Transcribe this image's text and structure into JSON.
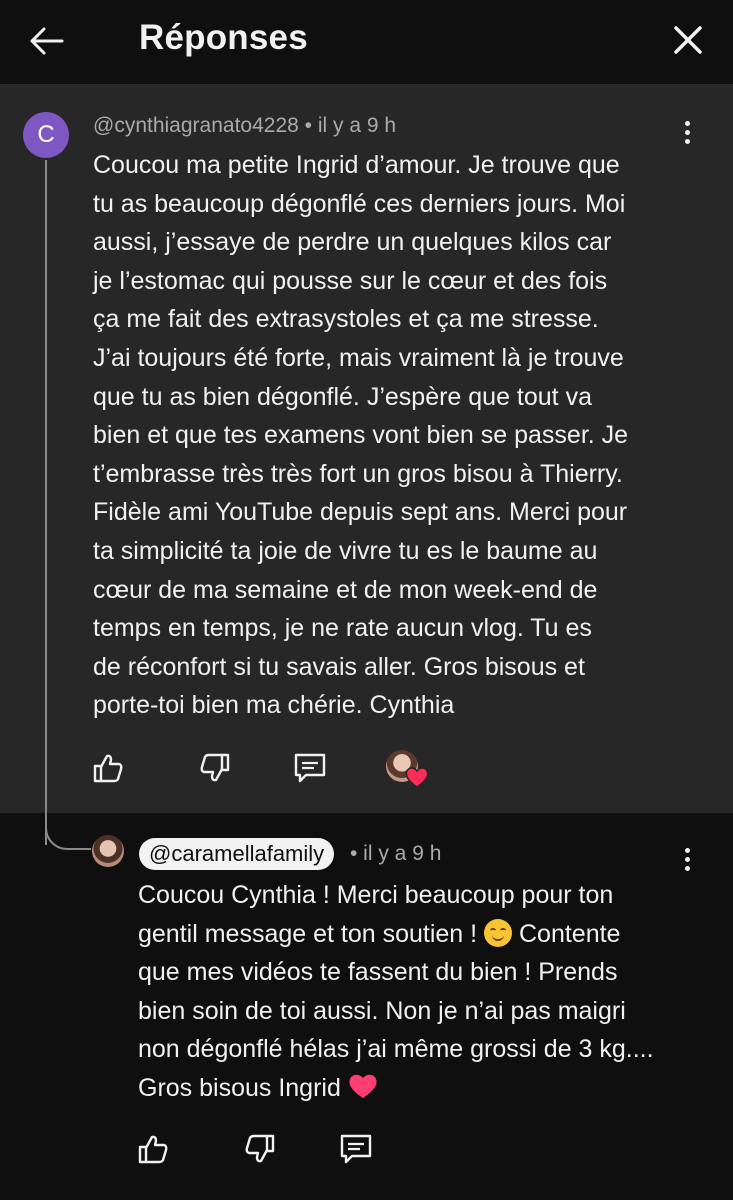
{
  "header": {
    "title": "Réponses",
    "back_icon": "arrow-left-icon",
    "close_icon": "close-icon"
  },
  "parent_comment": {
    "avatar_letter": "C",
    "avatar_color": "#7e57c2",
    "handle": "@cynthiagranato4228",
    "time": "• il y a 9 h",
    "lines": [
      "Coucou ma petite Ingrid d’amour. Je trouve que",
      "tu as beaucoup dégonflé ces derniers jours. Moi",
      "aussi, j’essaye de perdre un quelques kilos car",
      "je l’estomac qui pousse sur le cœur et des fois",
      "ça me fait des extrasystoles et ça me stresse.",
      "J’ai toujours été forte, mais vraiment là je trouve",
      "que tu as bien dégonflé. J’espère que tout va",
      "bien et que tes examens vont bien se passer. Je",
      "t’embrasse très très fort un gros bisou à Thierry.",
      "Fidèle ami YouTube depuis sept ans. Merci pour",
      "ta simplicité ta joie de vivre tu es le baume au",
      "cœur de ma semaine et de mon week-end de",
      "temps en temps, je ne rate aucun vlog. Tu es",
      "de réconfort si tu savais aller. Gros bisous et",
      "porte-toi bien ma chérie. Cynthia"
    ],
    "actions": [
      "thumbs-up-icon",
      "thumbs-down-icon",
      "reply-icon",
      "creator-heart-icon"
    ]
  },
  "reply": {
    "handle": "@caramellafamily",
    "time": "• il y a 9 h",
    "lines": [
      "Coucou Cynthia ! Merci beaucoup pour ton",
      "gentil message et ton soutien ! ",
      " Contente",
      "que mes vidéos te fassent du bien ! Prends",
      "bien soin de toi aussi. Non je n’ai pas maigri",
      "non dégonflé hélas j’ai même grossi de 3 kg....",
      "Gros bisous Ingrid "
    ],
    "actions": [
      "thumbs-up-icon",
      "thumbs-down-icon",
      "reply-icon"
    ]
  },
  "colors": {
    "background": "#0f0f0f",
    "parent_highlight": "#272727",
    "text": "#f1f1f1",
    "meta": "#aaaaaa",
    "heart": "#ff2c55"
  }
}
